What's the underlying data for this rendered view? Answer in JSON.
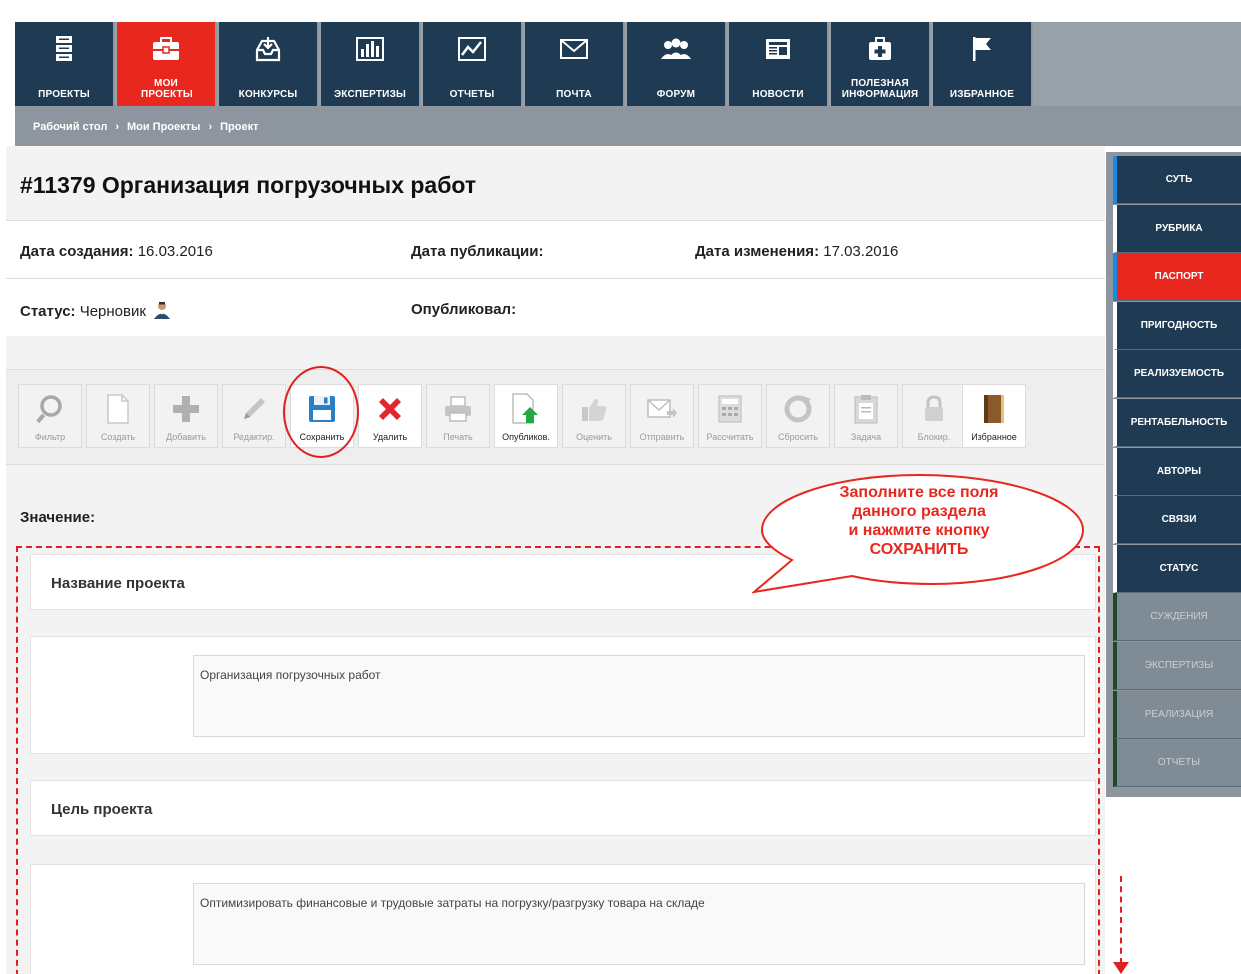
{
  "colors": {
    "nav_bg": "#1f3b53",
    "accent": "#e8281e",
    "side_active_marker": "#1e88e5"
  },
  "topnav": {
    "items": [
      {
        "label": "ПРОЕКТЫ",
        "icon": "server-icon"
      },
      {
        "label": "МОИ ПРОЕКТЫ",
        "icon": "briefcase-icon",
        "active": true
      },
      {
        "label": "КОНКУРСЫ",
        "icon": "inbox-download-icon"
      },
      {
        "label": "ЭКСПЕРТИЗЫ",
        "icon": "bar-chart-icon"
      },
      {
        "label": "ОТЧЕТЫ",
        "icon": "line-chart-icon"
      },
      {
        "label": "ПОЧТА",
        "icon": "envelope-icon"
      },
      {
        "label": "ФОРУМ",
        "icon": "users-icon"
      },
      {
        "label": "НОВОСТИ",
        "icon": "newspaper-icon"
      },
      {
        "label": "ПОЛЕЗНАЯ ИНФОРМАЦИЯ",
        "icon": "medkit-icon"
      },
      {
        "label": "ИЗБРАННОЕ",
        "icon": "flag-icon"
      }
    ]
  },
  "breadcrumb": {
    "items": [
      "Рабочий стол",
      "Мои Проекты",
      "Проект"
    ],
    "separator": "›"
  },
  "project": {
    "title": "#11379 Организация погрузочных работ",
    "created_label": "Дата создания:",
    "created_value": "16.03.2016",
    "published_label": "Дата публикации:",
    "published_value": "",
    "modified_label": "Дата изменения:",
    "modified_value": "17.03.2016",
    "status_label": "Статус:",
    "status_value": "Черновик",
    "publisher_label": "Опубликовал:",
    "publisher_value": ""
  },
  "toolbar": {
    "buttons": [
      {
        "label": "Фильтр",
        "icon": "magnifier-icon",
        "enabled": false
      },
      {
        "label": "Создать",
        "icon": "blank-page-icon",
        "enabled": false
      },
      {
        "label": "Добавить",
        "icon": "plus-icon",
        "enabled": false
      },
      {
        "label": "Редактир.",
        "icon": "pencil-icon",
        "enabled": false
      },
      {
        "label": "Сохранить",
        "icon": "floppy-disk-icon",
        "enabled": true
      },
      {
        "label": "Удалить",
        "icon": "red-x-icon",
        "enabled": true
      },
      {
        "label": "Печать",
        "icon": "printer-icon",
        "enabled": false
      },
      {
        "label": "Опубликов.",
        "icon": "upload-page-icon",
        "enabled": true
      },
      {
        "label": "Оценить",
        "icon": "thumbs-up-icon",
        "enabled": false
      },
      {
        "label": "Отправить",
        "icon": "send-mail-icon",
        "enabled": false
      },
      {
        "label": "Рассчитать",
        "icon": "calculator-icon",
        "enabled": false
      },
      {
        "label": "Сбросить",
        "icon": "refresh-icon",
        "enabled": false
      },
      {
        "label": "Задача",
        "icon": "clipboard-icon",
        "enabled": false
      },
      {
        "label": "Блокир.",
        "icon": "lock-icon",
        "enabled": false
      },
      {
        "label": "Избранное",
        "icon": "book-icon",
        "enabled": true
      }
    ]
  },
  "value_label": "Значение:",
  "callout": {
    "lines": [
      "Заполните все поля",
      "данного раздела",
      "и нажмите кнопку",
      "СОХРАНИТЬ"
    ]
  },
  "sections": [
    {
      "heading": "Название проекта",
      "value": "Организация погрузочных работ"
    },
    {
      "heading": "Цель проекта",
      "value": "Оптимизировать финансовые и трудовые затраты на погрузку/разгрузку товара на складе"
    }
  ],
  "sidenav": {
    "items": [
      {
        "label": "СУТЬ",
        "state": "normal"
      },
      {
        "label": "РУБРИКА",
        "state": "normal"
      },
      {
        "label": "ПАСПОРТ",
        "state": "active"
      },
      {
        "label": "ПРИГОДНОСТЬ",
        "state": "normal"
      },
      {
        "label": "РЕАЛИЗУЕМОСТЬ",
        "state": "normal"
      },
      {
        "label": "РЕНТАБЕЛЬНОСТЬ",
        "state": "normal"
      },
      {
        "label": "АВТОРЫ",
        "state": "normal"
      },
      {
        "label": "СВЯЗИ",
        "state": "normal"
      },
      {
        "label": "СТАТУС",
        "state": "normal"
      },
      {
        "label": "СУЖДЕНИЯ",
        "state": "disabled"
      },
      {
        "label": "ЭКСПЕРТИЗЫ",
        "state": "disabled"
      },
      {
        "label": "РЕАЛИЗАЦИЯ",
        "state": "disabled"
      },
      {
        "label": "ОТЧЕТЫ",
        "state": "disabled"
      }
    ]
  }
}
